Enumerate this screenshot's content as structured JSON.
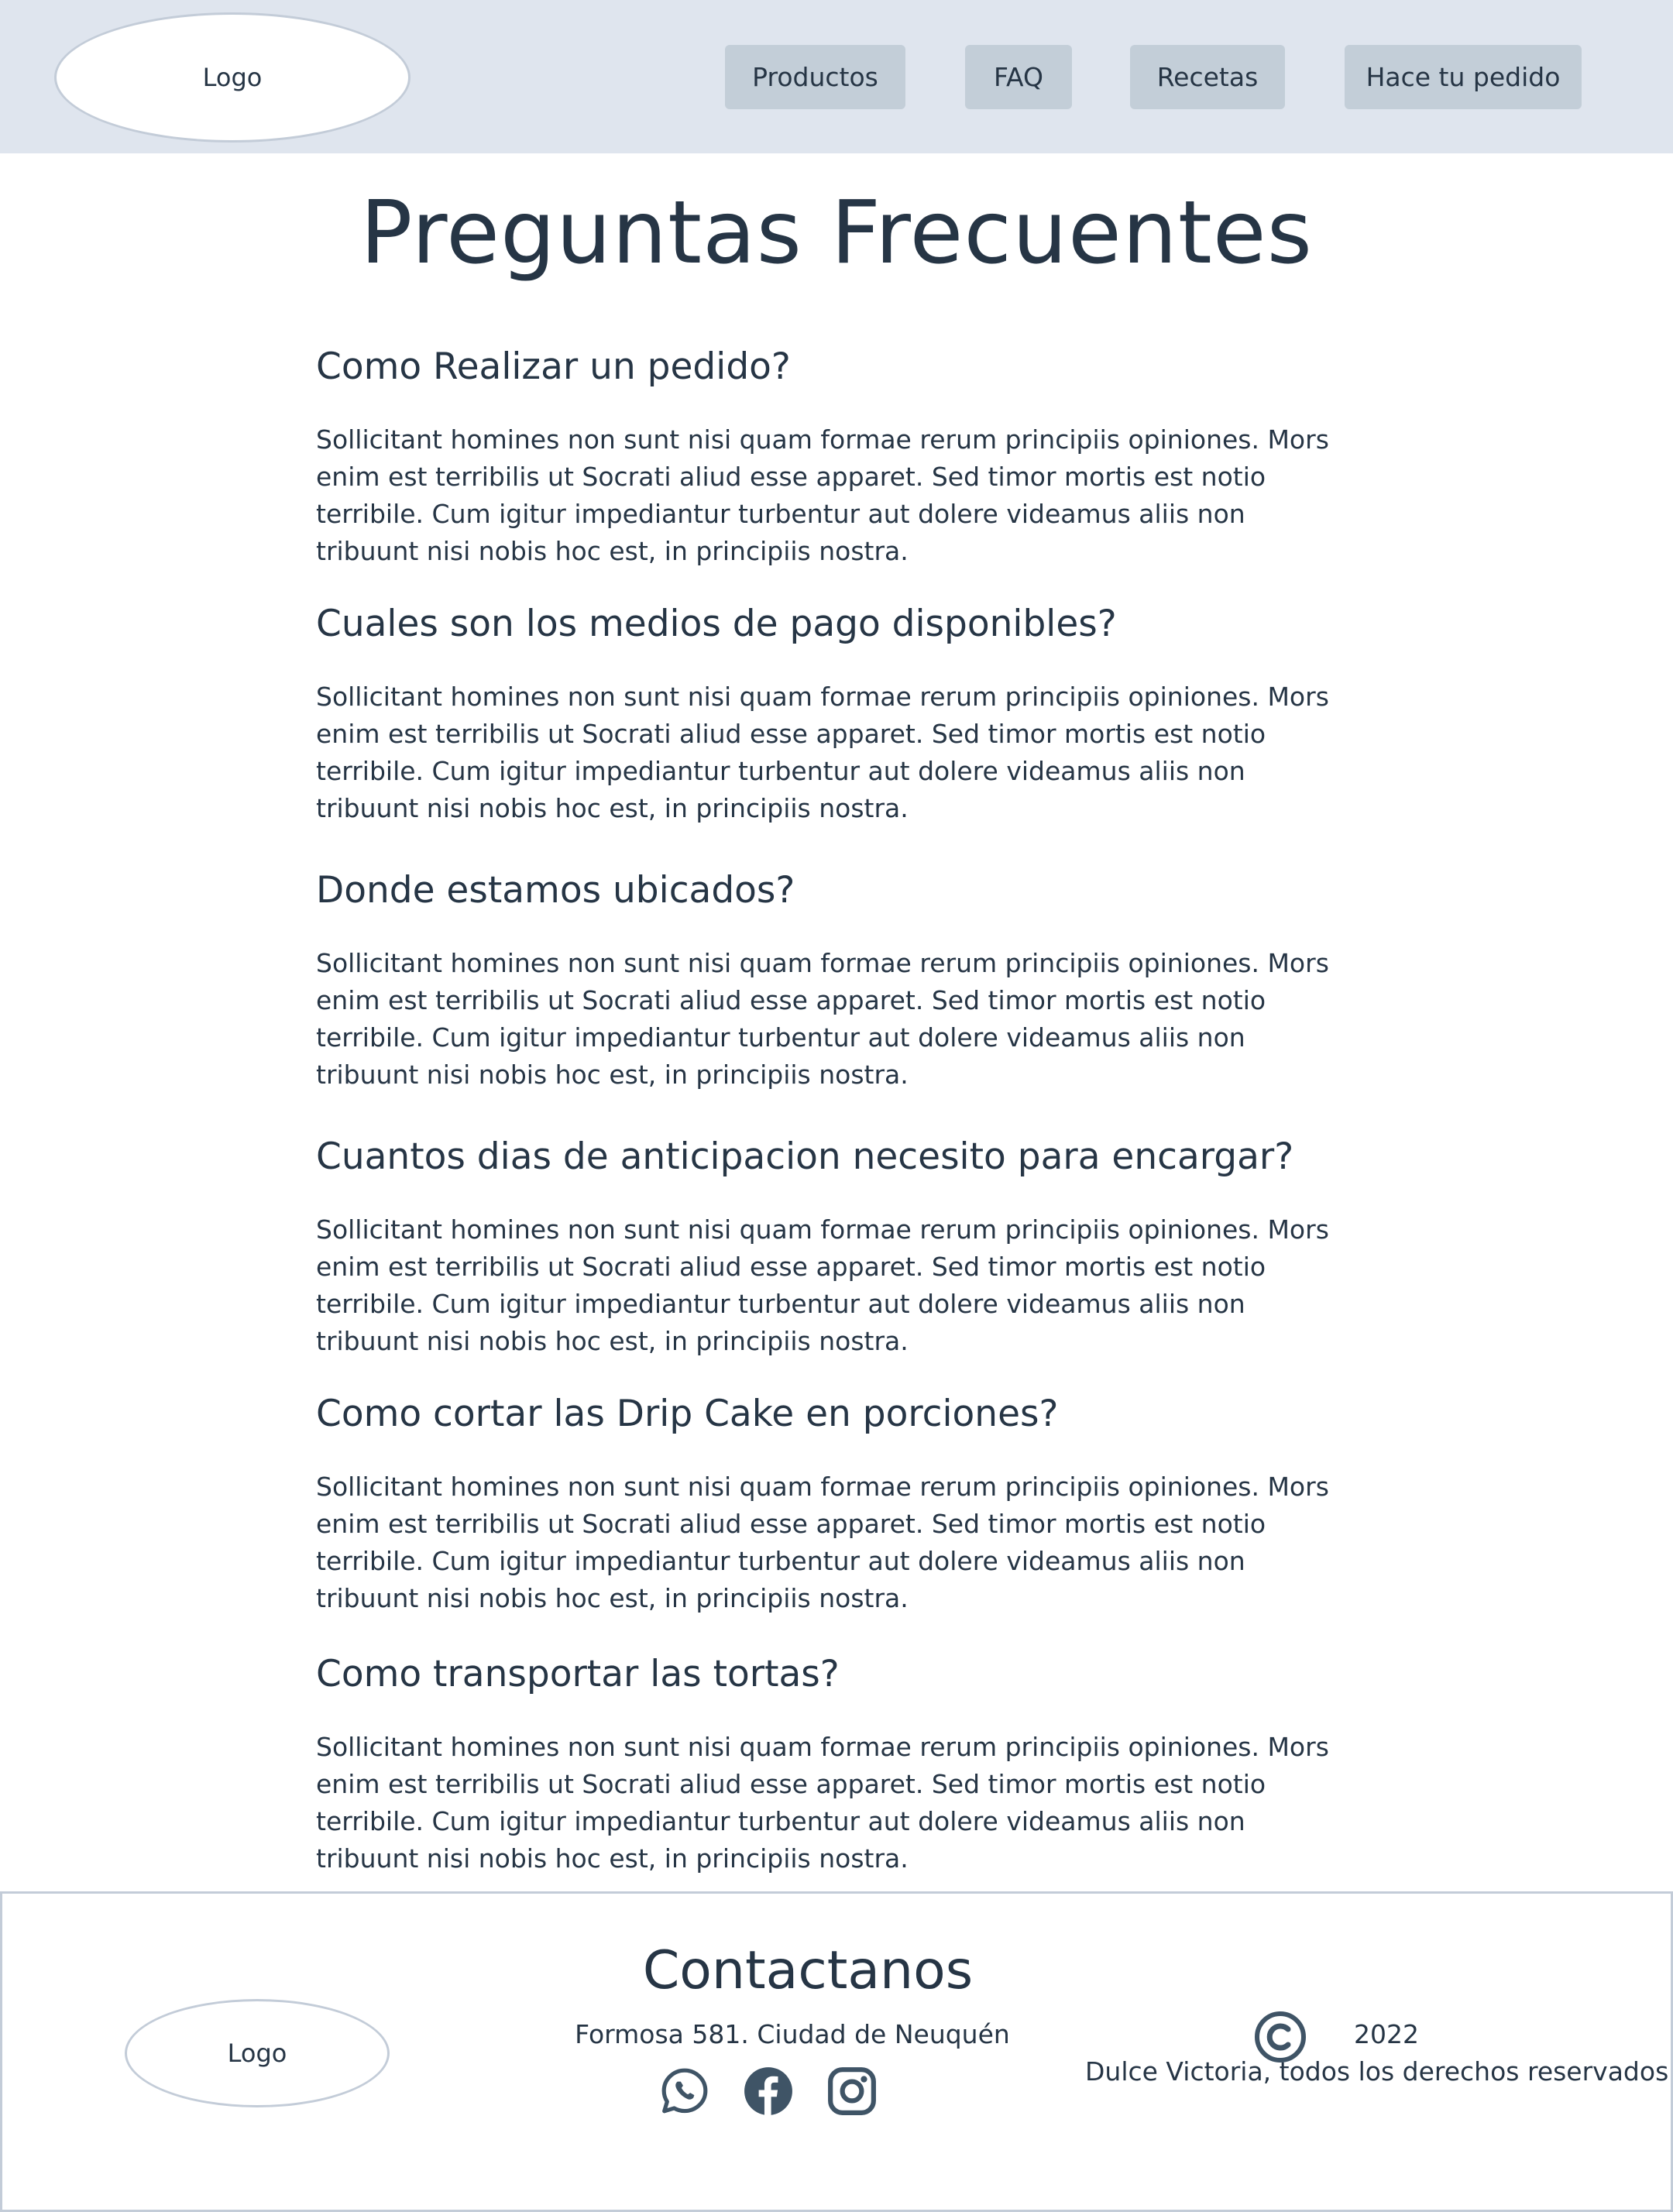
{
  "header": {
    "logo_label": "Logo",
    "nav": [
      {
        "label": "Productos"
      },
      {
        "label": "FAQ"
      },
      {
        "label": "Recetas"
      },
      {
        "label": "Hace tu pedido"
      }
    ]
  },
  "main": {
    "title": "Preguntas Frecuentes",
    "faqs": [
      {
        "question": "Como Realizar un pedido?",
        "answer": "Sollicitant homines non sunt nisi quam formae rerum principiis opiniones. Mors enim est terribilis ut Socrati aliud esse apparet. Sed timor mortis est notio terribile. Cum igitur impediantur turbentur aut dolere videamus aliis non tribuunt nisi nobis hoc est, in principiis nostra."
      },
      {
        "question": "Cuales son los medios de pago disponibles?",
        "answer": "Sollicitant homines non sunt nisi quam formae rerum principiis opiniones. Mors enim est terribilis ut Socrati aliud esse apparet. Sed timor mortis est notio terribile. Cum igitur impediantur turbentur aut dolere videamus aliis non tribuunt nisi nobis hoc est, in principiis nostra."
      },
      {
        "question": "Donde estamos ubicados?",
        "answer": "Sollicitant homines non sunt nisi quam formae rerum principiis opiniones. Mors enim est terribilis ut Socrati aliud esse apparet. Sed timor mortis est notio terribile. Cum igitur impediantur turbentur aut dolere videamus aliis non tribuunt nisi nobis hoc est, in principiis nostra."
      },
      {
        "question": "Cuantos dias de anticipacion necesito para encargar?",
        "answer": "Sollicitant homines non sunt nisi quam formae rerum principiis opiniones. Mors enim est terribilis ut Socrati aliud esse apparet. Sed timor mortis est notio terribile. Cum igitur impediantur turbentur aut dolere videamus aliis non tribuunt nisi nobis hoc est, in principiis nostra."
      },
      {
        "question": "Como cortar las Drip Cake en porciones?",
        "answer": "Sollicitant homines non sunt nisi quam formae rerum principiis opiniones. Mors enim est terribilis ut Socrati aliud esse apparet. Sed timor mortis est notio terribile. Cum igitur impediantur turbentur aut dolere videamus aliis non tribuunt nisi nobis hoc est, in principiis nostra."
      },
      {
        "question": "Como transportar las tortas?",
        "answer": "Sollicitant homines non sunt nisi quam formae rerum principiis opiniones. Mors enim est terribilis ut Socrati aliud esse apparet. Sed timor mortis est notio terribile. Cum igitur impediantur turbentur aut dolere videamus aliis non tribuunt nisi nobis hoc est, in principiis nostra."
      }
    ]
  },
  "footer": {
    "logo_label": "Logo",
    "title": "Contactanos",
    "address": "Formosa 581. Ciudad de Neuquén",
    "social_icons": [
      "whatsapp-icon",
      "facebook-icon",
      "instagram-icon"
    ],
    "copyright_year": "2022",
    "copyright_text": "Dulce Victoria, todos los derechos reservados"
  },
  "colors": {
    "header_bg": "#dfe5ee",
    "nav_button_bg": "#c3ced8",
    "text": "#263545",
    "border": "#c3ccd8"
  }
}
